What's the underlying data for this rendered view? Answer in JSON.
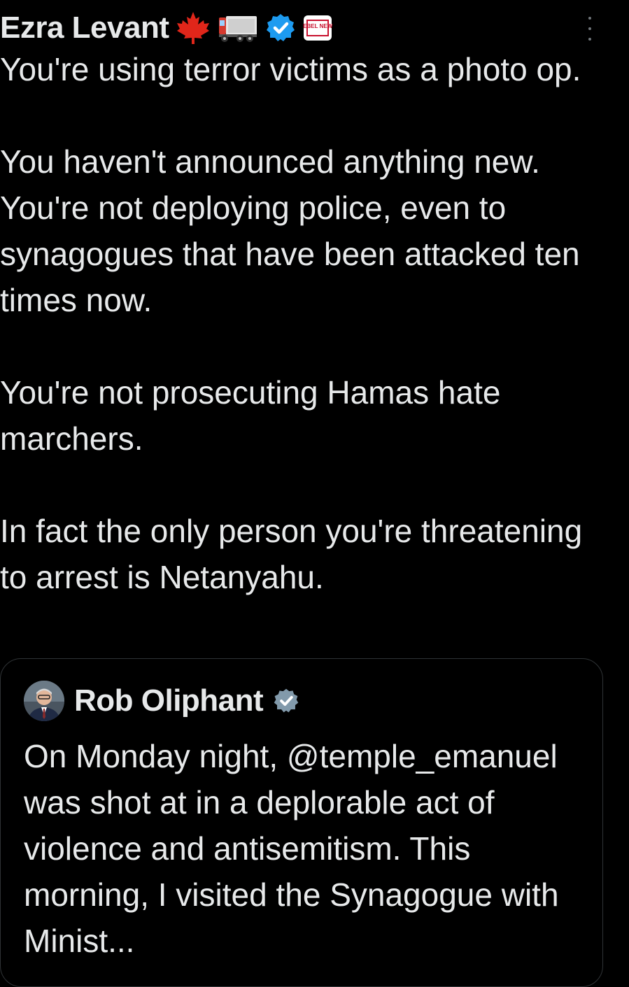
{
  "post": {
    "author_name": "Ezra Levant",
    "badges": [
      "maple-leaf-icon",
      "truck-icon",
      "verified-icon",
      "rebel-news-icon"
    ],
    "rebel_news_badge": "REBEL NEWS",
    "text": "You're using terror victims as a photo op.\n\nYou haven't announced anything new. You're not deploying police, even to synagogues that have been attacked ten times now.\n\nYou're not prosecuting Hamas hate marchers.\n\nIn fact the only person you're threatening to arrest is Netanyahu."
  },
  "quote": {
    "author_name": "Rob Oliphant",
    "badge": "government-verified-icon",
    "text": "On Monday night, @temple_emanuel was shot at in a deplorable act of violence and antisemitism. This morning, I visited the Synagogue with Minist..."
  },
  "colors": {
    "background": "#000000",
    "text": "#e7e9ea",
    "border": "#2f3336",
    "verified_blue": "#1d9bf0",
    "gov_badge_gray": "#829aab"
  }
}
